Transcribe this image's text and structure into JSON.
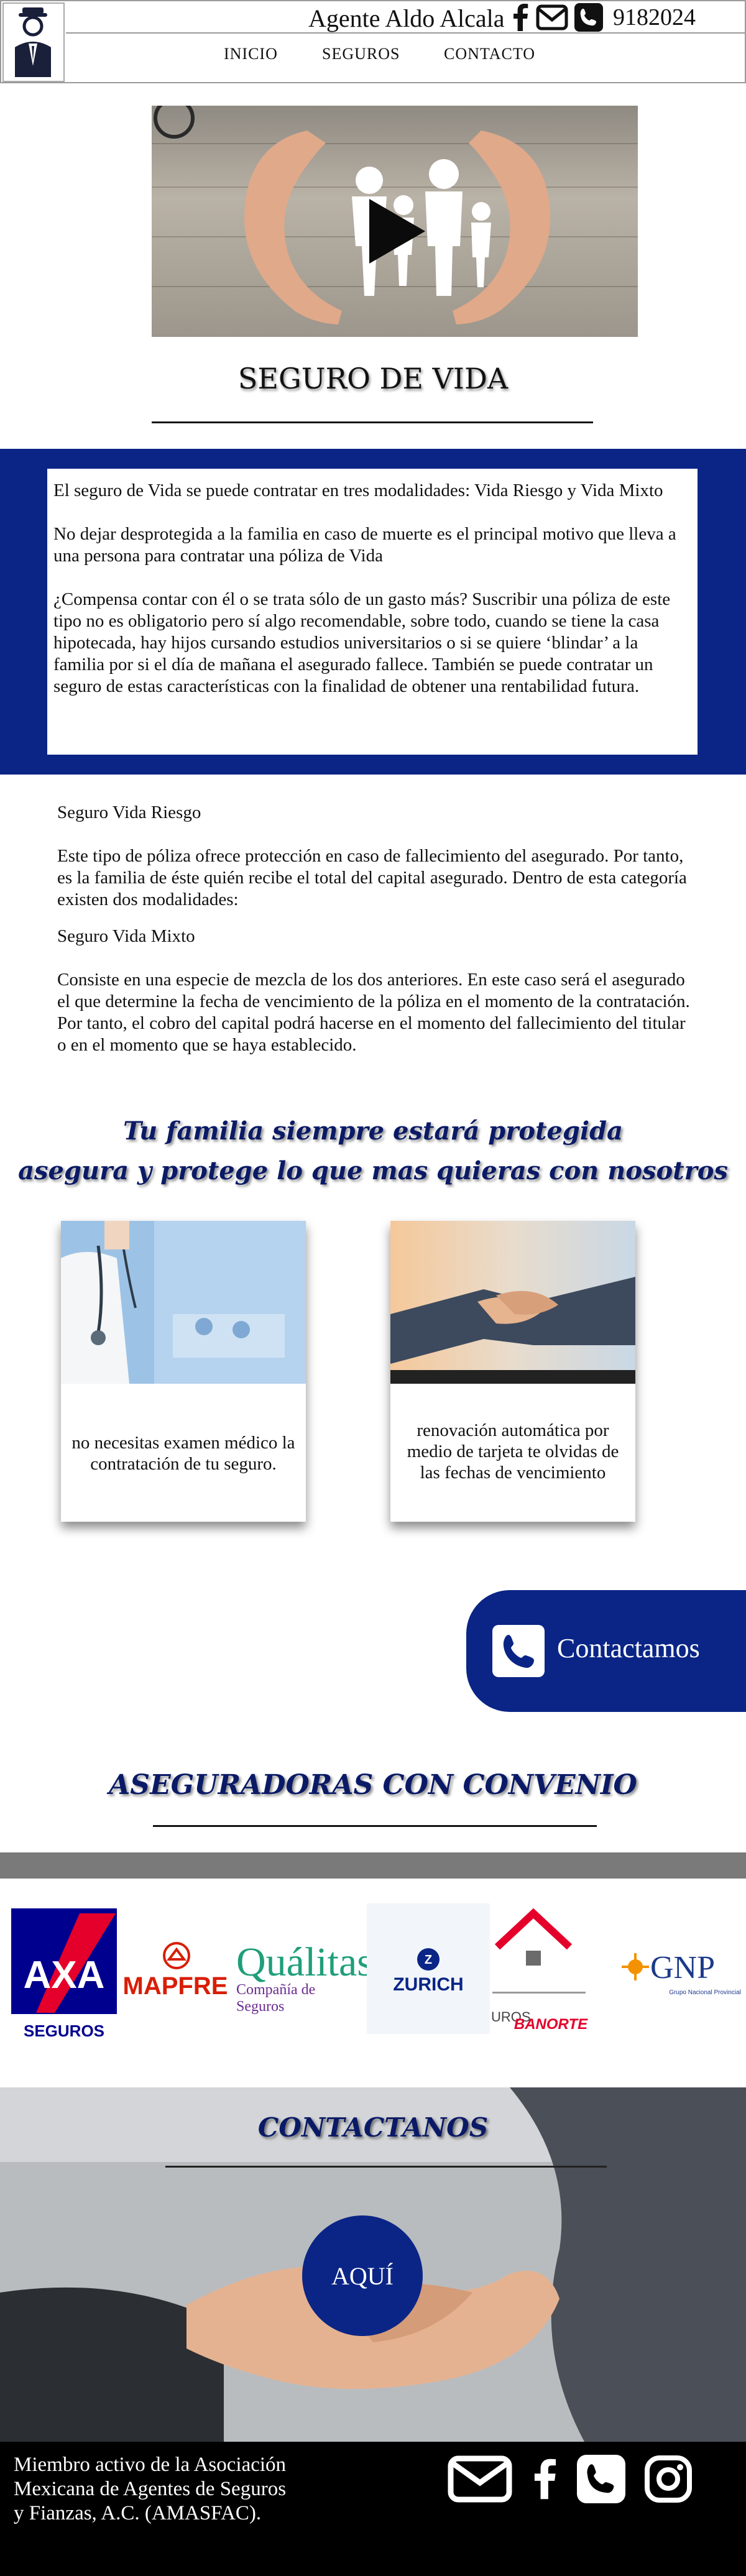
{
  "header": {
    "agent_name": "Agente Aldo Alcala",
    "phone": "9182024",
    "nav": [
      "INICIO",
      "SEGUROS",
      "CONTACTO"
    ]
  },
  "page_title": "SEGURO DE VIDA",
  "intro": {
    "p1": "El seguro de Vida se puede contratar en tres modalidades: Vida Riesgo y Vida Mixto",
    "p2": "No dejar desprotegida a la familia en caso de muerte es el principal motivo que lleva a una persona para contratar una póliza de Vida",
    "p3": "¿Compensa contar con él o se trata sólo de un gasto más? Suscribir una póliza de este tipo no es obligatorio pero sí algo recomendable, sobre todo, cuando se tiene la casa hipotecada, hay hijos cursando estudios universitarios o si se quiere ‘blindar’ a la familia por si el día de mañana el asegurado fallece. También se puede contratar un seguro de estas características con la finalidad de obtener una rentabilidad futura."
  },
  "details": {
    "riesgo_title": "Seguro Vida Riesgo",
    "riesgo_text": "Este tipo de póliza ofrece protección en caso de fallecimiento del asegurado. Por tanto, es la familia de éste quién recibe el total del capital asegurado. Dentro de esta categoría existen dos modalidades:",
    "mixto_title": "Seguro Vida Mixto",
    "mixto_text": "Consiste en una especie de mezcla de los dos anteriores. En este caso será el asegurado el que determine la fecha de vencimiento de la póliza en el momento de la contratación. Por tanto, el cobro del capital podrá hacerse en el momento del fallecimiento del titular o en el momento que se haya establecido."
  },
  "slogan": {
    "line1": "Tu familia siempre estará protegida",
    "line2": "asegura y protege lo que mas quieras con nosotros"
  },
  "cards": [
    {
      "text": "no necesitas examen médico la contratación de tu seguro."
    },
    {
      "text": "renovación automática por medio de tarjeta te olvidas de las fechas de vencimiento"
    }
  ],
  "contact_button": "Contactamos",
  "insurers_title": "ASEGURADORAS CON CONVENIO",
  "insurers": {
    "axa": "AXA",
    "axa_sub": "SEGUROS",
    "mapfre": "MAPFRE",
    "qualitas": "Quálitas",
    "qualitas_sub": "Compañía de Seguros",
    "zurich": "ZURICH",
    "banorte": "BANORTE",
    "banorte_prefix": "UROS",
    "gnp": "GNP",
    "gnp_sub": "Grupo Nacional Provincial"
  },
  "contact_section": {
    "title": "CONTACTANOS",
    "button": "AQUÍ"
  },
  "footer": {
    "text": "Miembro activo de la Asociación Mexicana de Agentes de Seguros y Fianzas, A.C. (AMASFAC)."
  },
  "colors": {
    "navy": "#0a2586",
    "slogan": "#0a1a66",
    "axa_red": "#e4002b",
    "mapfre_red": "#d81e05",
    "qualitas_purple": "#6b2c91",
    "gnp_orange": "#f39200"
  }
}
